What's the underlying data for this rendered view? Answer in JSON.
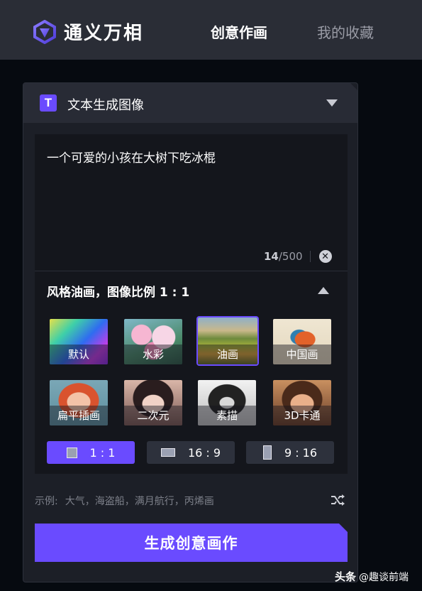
{
  "header": {
    "app_name": "通义万相",
    "nav": [
      {
        "label": "创意作画",
        "active": true
      },
      {
        "label": "我的收藏",
        "active": false
      }
    ]
  },
  "panel": {
    "mode_icon_letter": "T",
    "mode_title": "文本生成图像",
    "prompt_text": "一个可爱的小孩在大树下吃冰棍",
    "char_count": "14",
    "char_limit": "/500",
    "style_summary": "风格油画，图像比例 1 : 1",
    "styles": [
      {
        "label": "默认",
        "selected": false,
        "icon": "gradient"
      },
      {
        "label": "水彩",
        "selected": false,
        "icon": "flowers"
      },
      {
        "label": "油画",
        "selected": true,
        "icon": "landscape"
      },
      {
        "label": "中国画",
        "selected": false,
        "icon": "bird"
      },
      {
        "label": "扁平插画",
        "selected": false,
        "icon": "flat-portrait"
      },
      {
        "label": "二次元",
        "selected": false,
        "icon": "anime-portrait"
      },
      {
        "label": "素描",
        "selected": false,
        "icon": "dog-sketch"
      },
      {
        "label": "3D卡通",
        "selected": false,
        "icon": "cartoon-girl"
      }
    ],
    "ratios": [
      {
        "label": "1 : 1",
        "selected": true
      },
      {
        "label": "16 : 9",
        "selected": false
      },
      {
        "label": "9 : 16",
        "selected": false
      }
    ],
    "examples_label": "示例:",
    "examples_items": "大气，海盗船，满月航行，丙烯画",
    "generate_label": "生成创意画作"
  },
  "watermark": {
    "brand": "头条",
    "handle": "@趣谈前端"
  },
  "colors": {
    "accent": "#6a4bff",
    "panel": "#1c1f27",
    "background": "#060a10"
  }
}
